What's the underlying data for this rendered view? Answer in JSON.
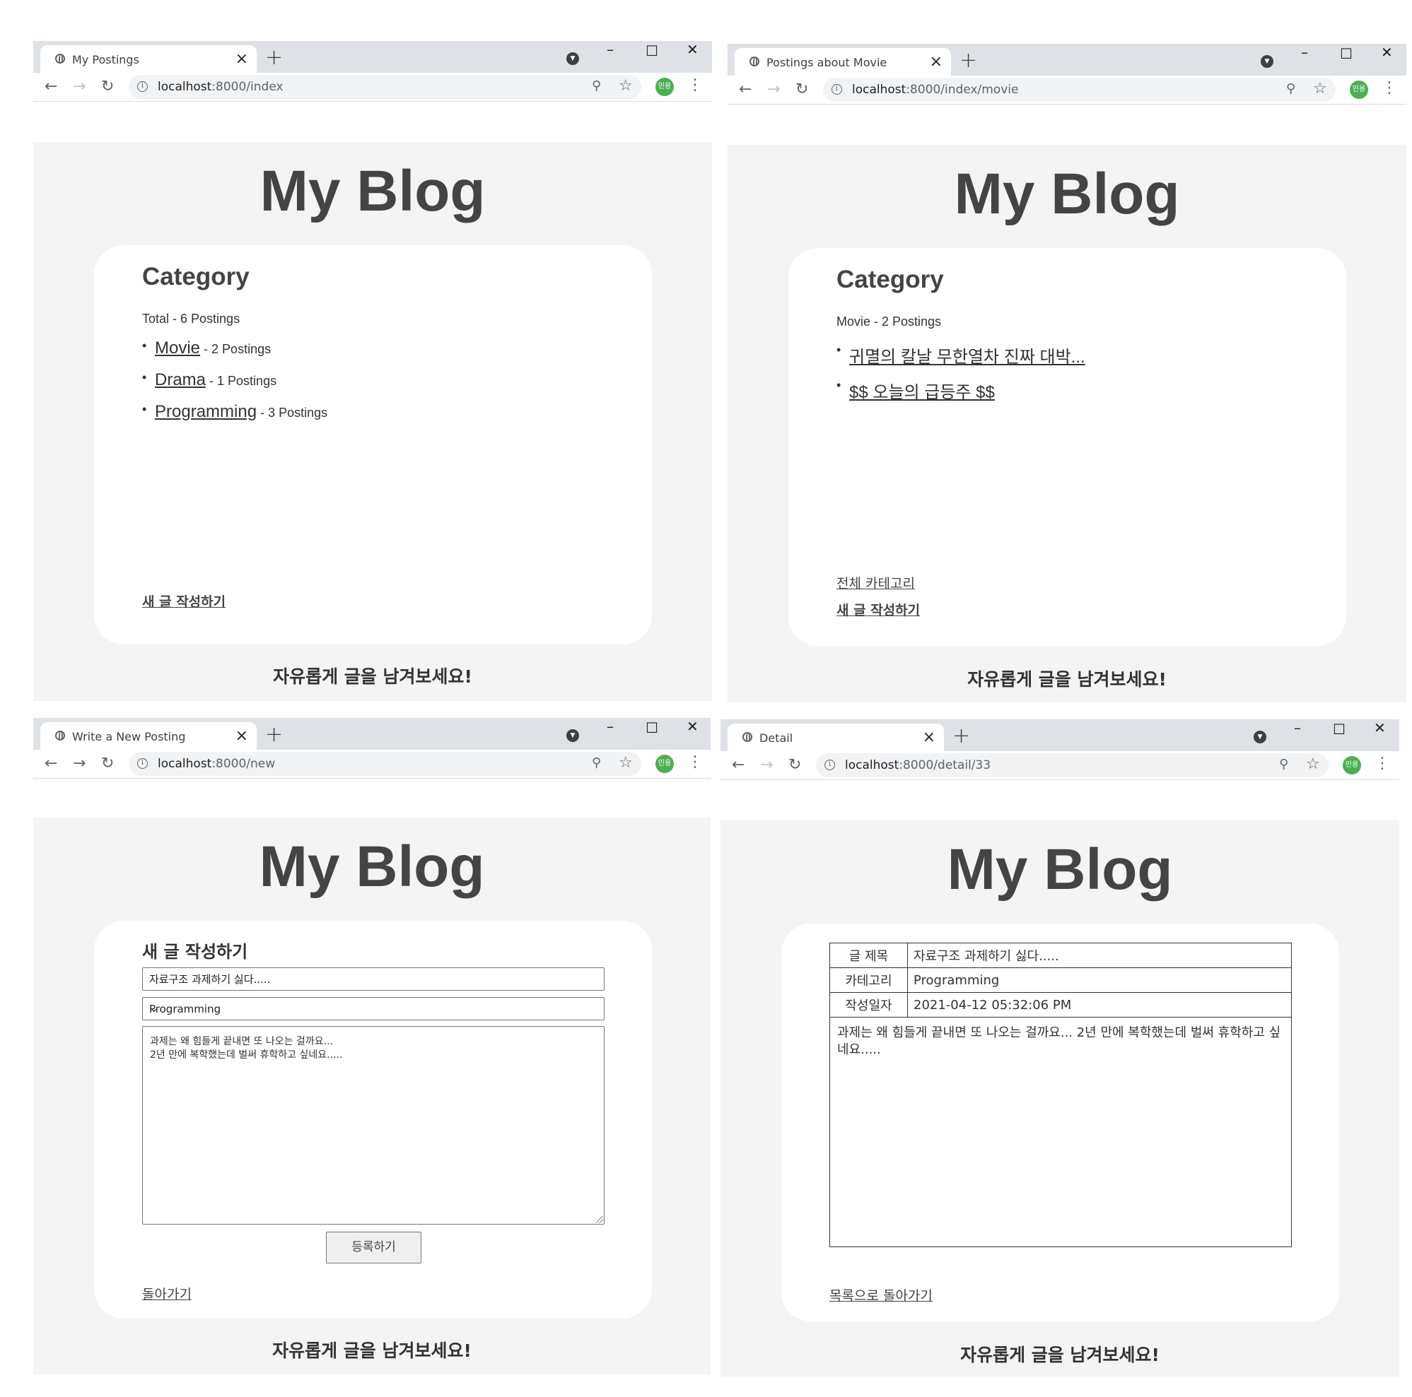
{
  "shared": {
    "blog_title": "My Blog",
    "footer": "자유롭게 글을 남겨보세요!",
    "avatar_label": "민용"
  },
  "w1": {
    "tab_title": "My Postings",
    "url_host": "localhost",
    "url_path": ":8000/index",
    "heading": "Category",
    "total": "Total - 6 Postings",
    "categories": [
      {
        "name": "Movie",
        "count": "- 2 Postings"
      },
      {
        "name": "Drama",
        "count": "- 1 Postings"
      },
      {
        "name": "Programming",
        "count": "- 3 Postings"
      }
    ],
    "new_post_link": "새 글 작성하기"
  },
  "w2": {
    "tab_title": "Postings about Movie",
    "url_host": "localhost",
    "url_path": ":8000/index/movie",
    "heading": "Category",
    "total": "Movie - 2 Postings",
    "posts": [
      "귀멸의 칼날 무한열차 진짜 대박...",
      "$$ 오늘의 급등주 $$"
    ],
    "all_categories_link": "전체 카테고리",
    "new_post_link": "새 글 작성하기"
  },
  "w3": {
    "tab_title": "Write a New Posting",
    "url_host": "localhost",
    "url_path": ":8000/new",
    "heading": "새 글 작성하기",
    "title_value": "자료구조 과제하기 싫다.....",
    "category_value": "Programming",
    "body_value": "과제는 왜 힘들게 끝내면 또 나오는 걸까요...\n2년 만에 복학했는데 벌써 휴학하고 싶네요.....",
    "submit_label": "등록하기",
    "back_link": "돌아가기"
  },
  "w4": {
    "tab_title": "Detail",
    "url_host": "localhost",
    "url_path": ":8000/detail/33",
    "labels": {
      "title": "글 제목",
      "category": "카테고리",
      "date": "작성일자"
    },
    "values": {
      "title": "자료구조 과제하기 싫다.....",
      "category": "Programming",
      "date": "2021-04-12 05:32:06 PM"
    },
    "content": "과제는 왜 힘들게 끝내면 또 나오는 걸까요... 2년 만에 복학했는데 벌써 휴학하고 싶네요.....",
    "back_link": "목록으로 돌아가기"
  }
}
